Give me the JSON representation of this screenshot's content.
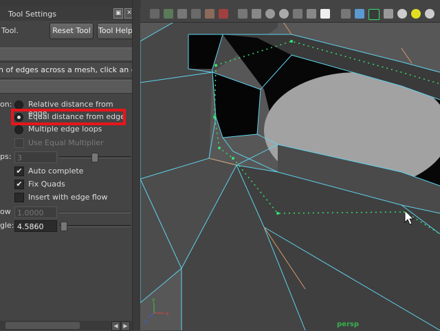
{
  "window": {
    "title": "Tool Settings",
    "tool_name": "Tool.",
    "reset_label": "Reset Tool",
    "help_label": "Tool Help"
  },
  "description": "h of edges across a mesh, click an edge",
  "options": {
    "side_label_mode": "on:",
    "relative_label": "Relative distance from edge",
    "equal_label": "Equal distance from edge",
    "multiple_label": "Multiple edge loops",
    "use_equal_multiplier_label": "Use Equal Multiplier",
    "side_label_loops": "ps:",
    "loops_value": "3",
    "auto_complete_label": "Auto complete",
    "fix_quads_label": "Fix Quads",
    "edge_flow_label": "Insert with edge flow",
    "side_label_flow": "ow",
    "flow_value": "1.0000",
    "side_label_angle": "gle:",
    "angle_value": "4.5860",
    "auto_complete_checked": true,
    "fix_quads_checked": true,
    "edge_flow_checked": false,
    "selected_radio": "equal"
  },
  "viewport": {
    "camera_label": "persp",
    "axis_x": "x",
    "axis_y": "y",
    "axis_z": "z"
  },
  "colors": {
    "highlight": "#e8151b",
    "wire": "#5fd3ee",
    "edge_loop_preview": "#35e36f",
    "accent_edge": "#d89a6a"
  }
}
